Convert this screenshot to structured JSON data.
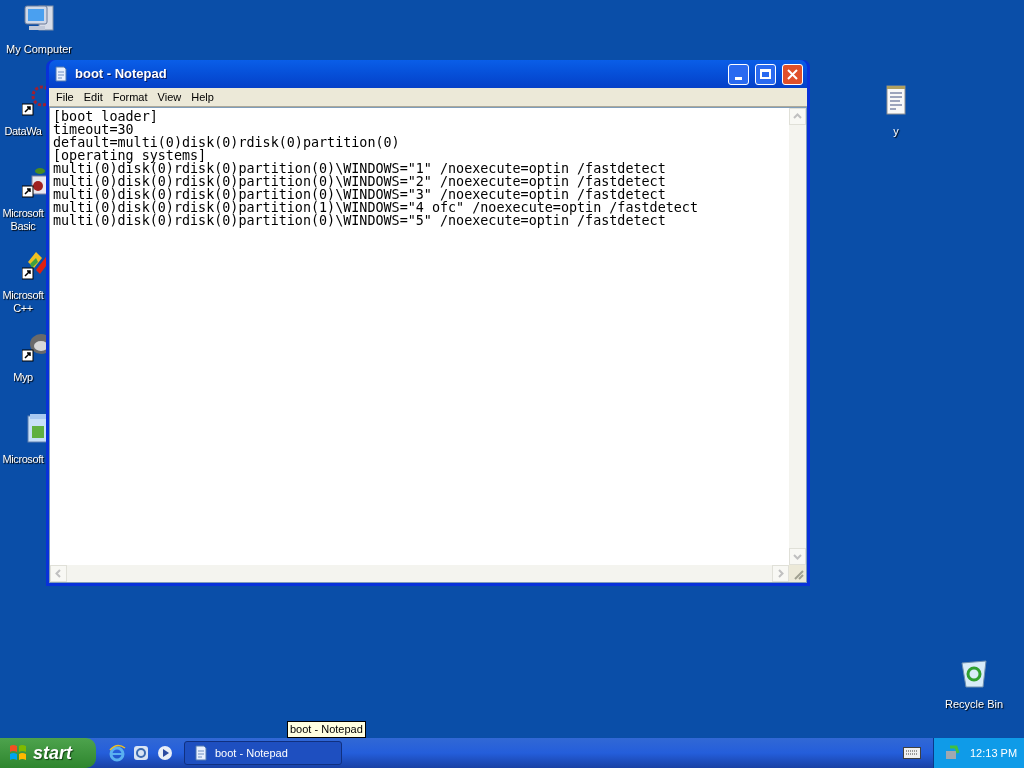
{
  "desktop_icons": [
    {
      "kind": "computer",
      "label": "My Computer"
    },
    {
      "kind": "shortcut-red",
      "label": "DataWa"
    },
    {
      "kind": "shortcut-basic",
      "label": "Microsoft Basic"
    },
    {
      "kind": "shortcut-cpp",
      "label": "Microsoft C++"
    },
    {
      "kind": "shortcut-raccoon",
      "label": "Myp"
    },
    {
      "kind": "installer",
      "label": "Microsoft"
    },
    {
      "kind": "notepad-file",
      "label": "y"
    },
    {
      "kind": "recycle-bin",
      "label": "Recycle Bin"
    }
  ],
  "window": {
    "title": "boot - Notepad",
    "menu": [
      "File",
      "Edit",
      "Format",
      "View",
      "Help"
    ],
    "lines": [
      "[boot loader]",
      "timeout=30",
      "default=multi(0)disk(0)rdisk(0)partition(0)",
      "[operating systems]",
      "multi(0)disk(0)rdisk(0)partition(0)\\WINDOWS=\"1\" /noexecute=optin /fastdetect",
      "multi(0)disk(0)rdisk(0)partition(0)\\WINDOWS=\"2\" /noexecute=optin /fastdetect",
      "multi(0)disk(0)rdisk(0)partition(0)\\WINDOWS=\"3\" /noexecute=optin /fastdetect",
      "multi(0)disk(0)rdisk(0)partition(1)\\WINDOWS=\"4 ofc\" /noexecute=optin /fastdetect",
      "multi(0)disk(0)rdisk(0)partition(0)\\WINDOWS=\"5\" /noexecute=optin /fastdetect"
    ]
  },
  "tooltip": "boot - Notepad",
  "taskbar": {
    "start": "start",
    "tasks": [
      {
        "label": "boot - Notepad",
        "selected": true
      }
    ],
    "clock": "12:13 PM"
  }
}
